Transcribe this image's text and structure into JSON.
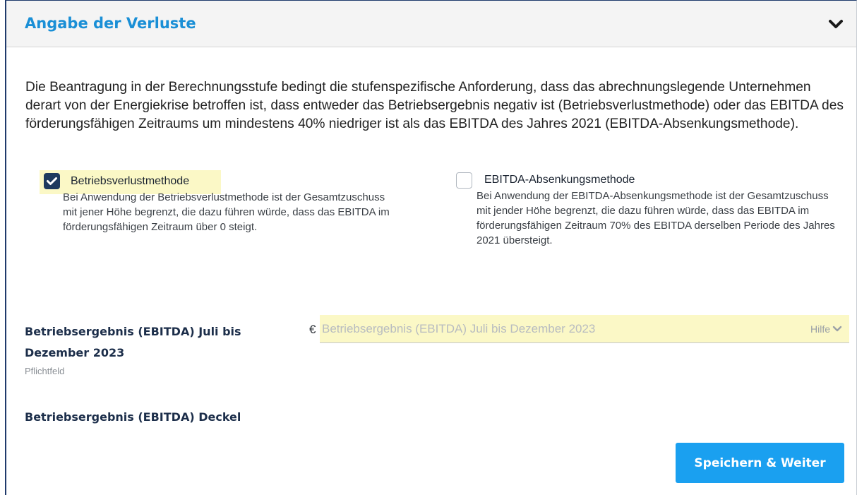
{
  "section": {
    "title": "Angabe der Verluste",
    "intro": "Die Beantragung in der Berechnungsstufe bedingt die stufenspezifische Anforderung, dass das abrechnungslegende Unternehmen derart von der Energiekrise betroffen ist, dass entweder das Betriebsergebnis negativ ist (Betriebsverlustmethode) oder das EBITDA des förderungsfähigen Zeitraums um mindestens 40% niedriger ist als das EBITDA des Jahres 2021 (EBITDA-Absenkungsmethode)."
  },
  "options": [
    {
      "label": "Betriebsverlustmethode",
      "checked": true,
      "description": "Bei Anwendung der Betriebsverlustmethode ist der Gesamtzuschuss mit jener Höhe begrenzt, die dazu führen würde, dass das EBITDA im förderungsfähigen Zeitraum über 0 steigt."
    },
    {
      "label": "EBITDA-Absenkungsmethode",
      "checked": false,
      "description": "Bei Anwendung der EBITDA-Absenkungsmethode ist der Gesamtzuschuss mit jender Höhe begrenzt, die dazu führen würde, dass das EBITDA im förderungsfähigen Zeitraum 70% des EBITDA derselben Periode des Jahres 2021 übersteigt."
    }
  ],
  "ebitda_field": {
    "label": "Betriebsergebnis (EBITDA) Juli bis Dezember 2023",
    "required_text": "Pflichtfeld",
    "currency": "€",
    "value": "",
    "placeholder": "Betriebsergebnis (EBITDA) Juli bis Dezember 2023",
    "help_label": "Hilfe"
  },
  "deckel_label": "Betriebsergebnis (EBITDA) Deckel",
  "save_button_label": "Speichern & Weiter",
  "colors": {
    "accent": "#1aa0f0",
    "title": "#1a8fd6",
    "highlight": "#fbf8c6",
    "checkbox_checked": "#1e3a5e"
  },
  "icons": {
    "collapse": "chevron-down-icon",
    "checkbox_checked": "checkmark-icon",
    "help": "chevron-down-icon"
  }
}
